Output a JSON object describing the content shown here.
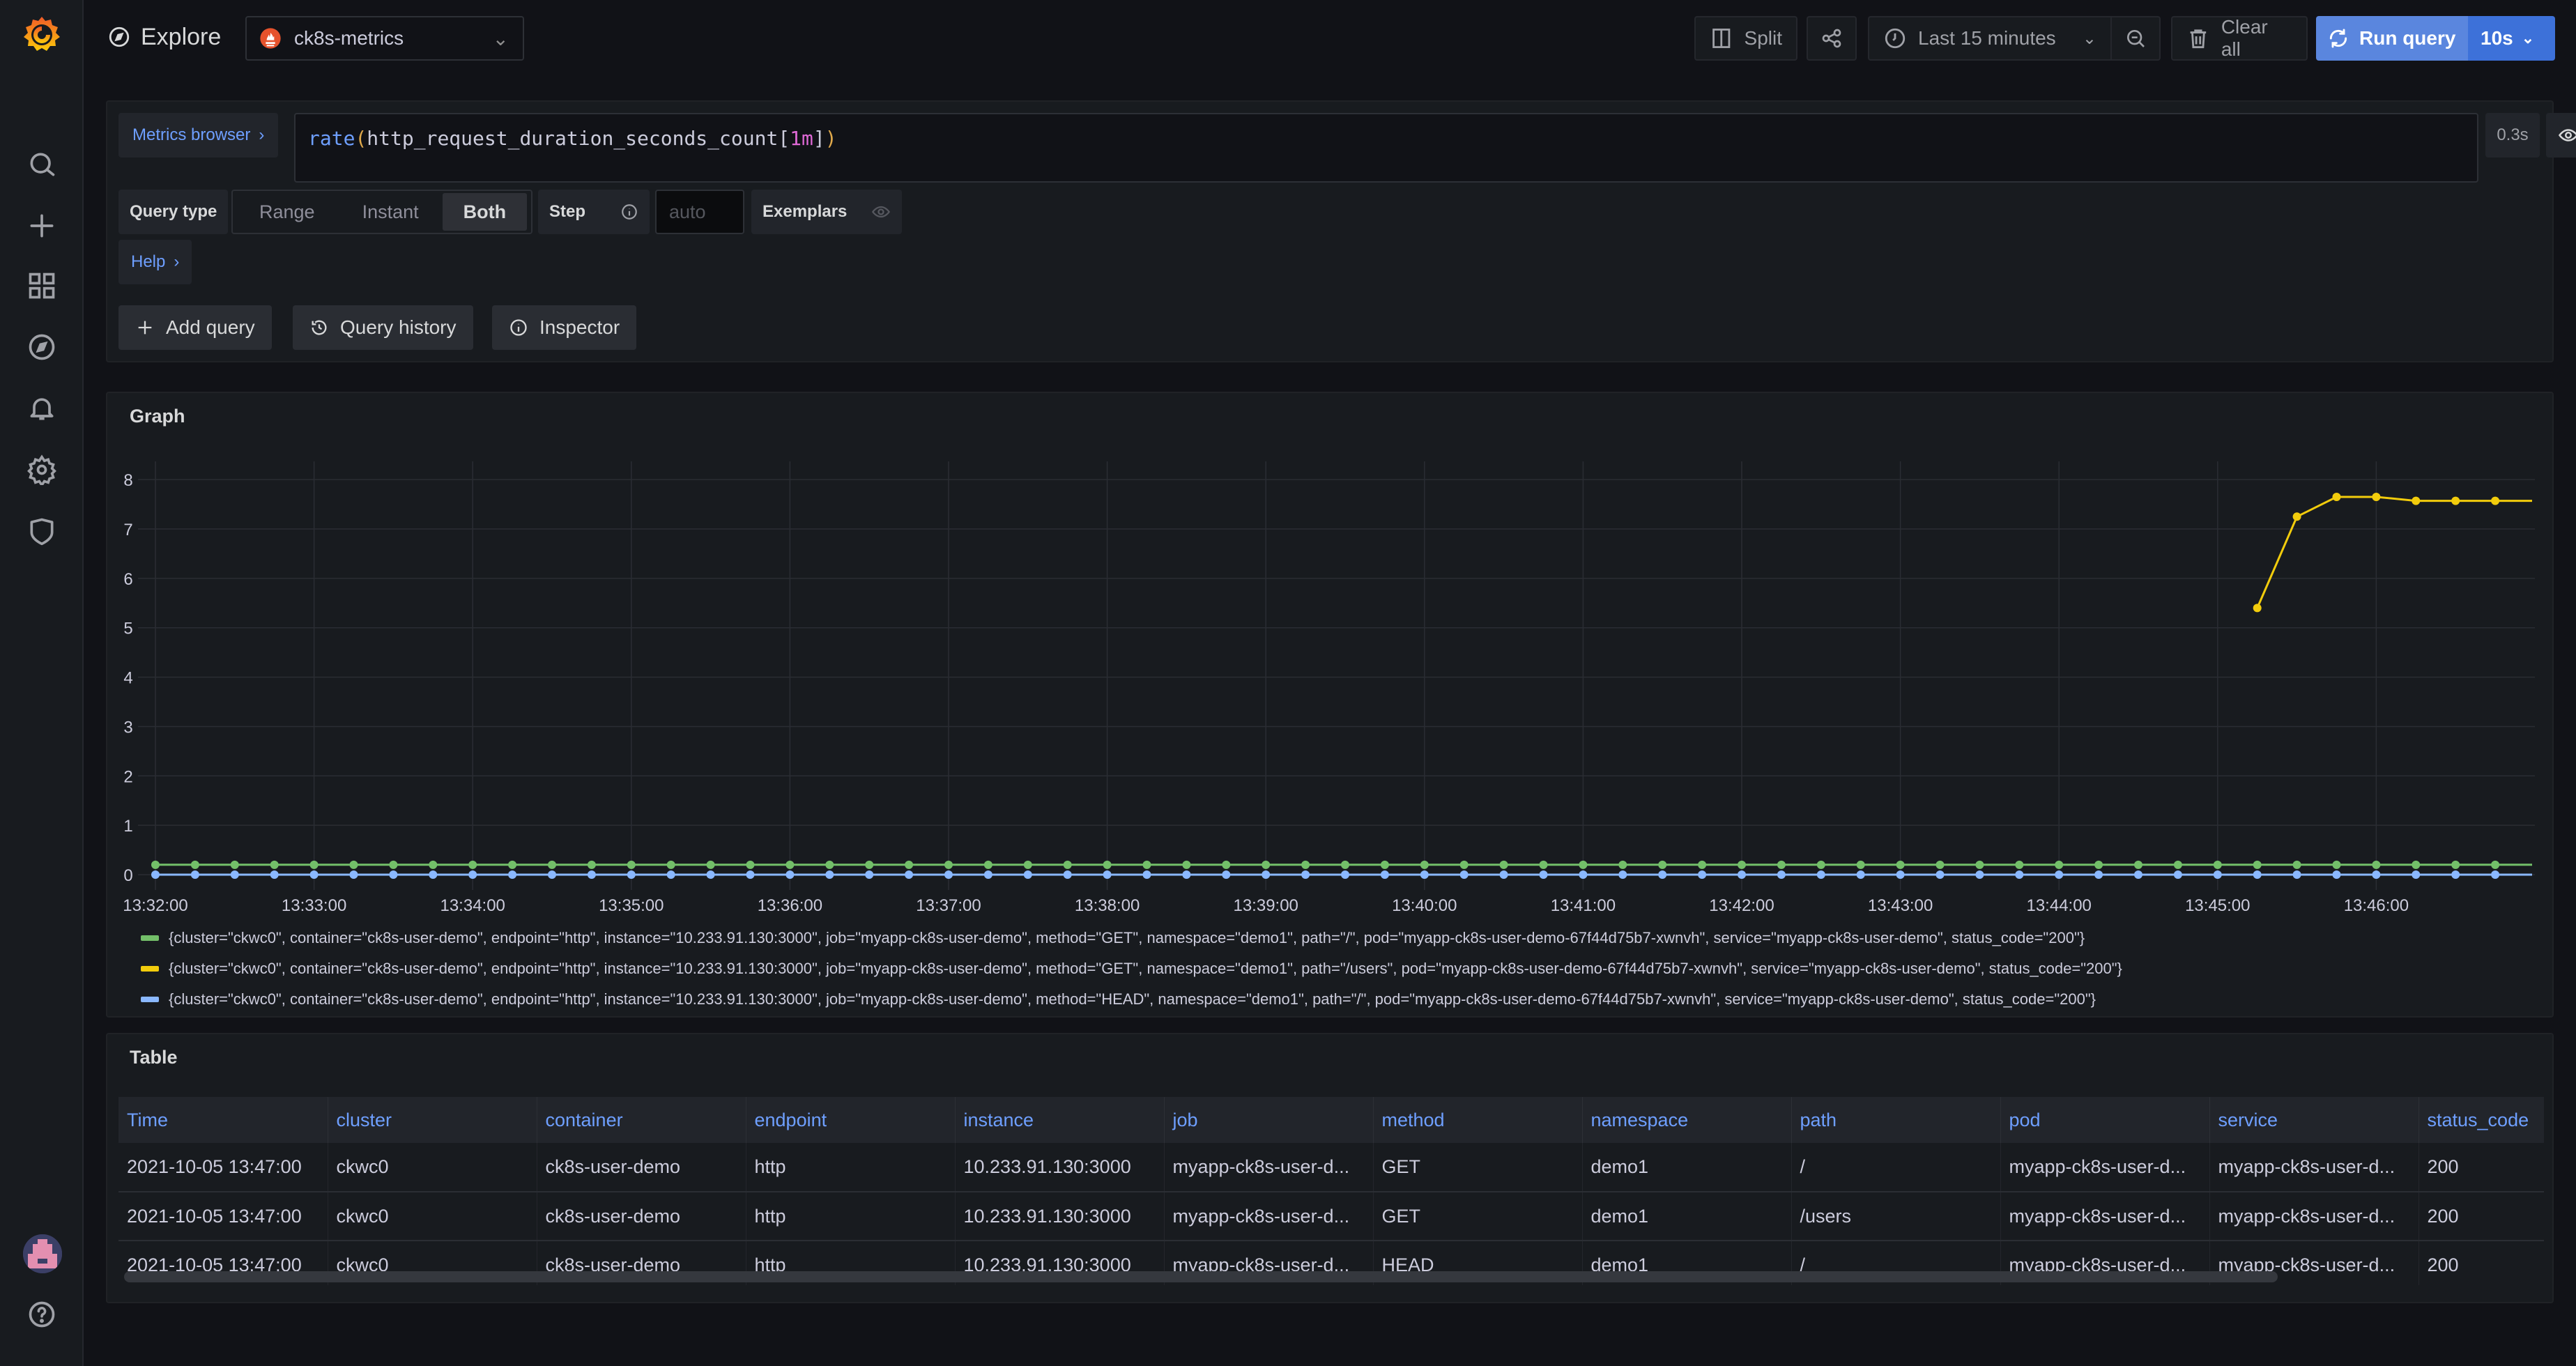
{
  "sidebar": {
    "items": [
      {
        "name": "search",
        "label": "Search"
      },
      {
        "name": "create",
        "label": "Create"
      },
      {
        "name": "dashboards",
        "label": "Dashboards"
      },
      {
        "name": "explore",
        "label": "Explore"
      },
      {
        "name": "alerting",
        "label": "Alerting"
      },
      {
        "name": "configuration",
        "label": "Configuration"
      },
      {
        "name": "server-admin",
        "label": "Server Admin"
      }
    ]
  },
  "topbar": {
    "title": "Explore",
    "datasource": "ck8s-metrics",
    "split_label": "Split",
    "time_range": "Last 15 minutes",
    "clear_all_label": "Clear all",
    "run_query_label": "Run query",
    "refresh_interval": "10s"
  },
  "query": {
    "metrics_browser_label": "Metrics browser",
    "expression_fn": "rate",
    "expression_metric": "http_request_duration_seconds_count",
    "expression_range": "1m",
    "duration": "0.3s",
    "query_type_label": "Query type",
    "query_type_options": [
      "Range",
      "Instant",
      "Both"
    ],
    "query_type_selected": "Both",
    "step_label": "Step",
    "step_placeholder": "auto",
    "exemplars_label": "Exemplars",
    "help_label": "Help",
    "add_query_label": "Add query",
    "query_history_label": "Query history",
    "inspector_label": "Inspector"
  },
  "graph": {
    "title": "Graph"
  },
  "chart_data": {
    "type": "line",
    "title": "Graph",
    "xlabel": "",
    "ylabel": "",
    "x_ticks": [
      "13:32:00",
      "13:33:00",
      "13:34:00",
      "13:35:00",
      "13:36:00",
      "13:37:00",
      "13:38:00",
      "13:39:00",
      "13:40:00",
      "13:41:00",
      "13:42:00",
      "13:43:00",
      "13:44:00",
      "13:45:00",
      "13:46:00"
    ],
    "y_ticks": [
      0,
      1,
      2,
      3,
      4,
      5,
      6,
      7,
      8
    ],
    "ylim": [
      0,
      8.2
    ],
    "xlim": [
      "13:32:00",
      "13:47:00"
    ],
    "grid": true,
    "legend_position": "bottom",
    "sample_interval_seconds": 15,
    "series": [
      {
        "name": "{cluster=\"ckwc0\", container=\"ck8s-user-demo\", endpoint=\"http\", instance=\"10.233.91.130:3000\", job=\"myapp-ck8s-user-demo\", method=\"GET\", namespace=\"demo1\", path=\"/\", pod=\"myapp-ck8s-user-demo-67f44d75b7-xwnvh\", service=\"myapp-ck8s-user-demo\", status_code=\"200\"}",
        "color": "#73bf69",
        "start": "13:32:00",
        "values": [
          0.2,
          0.2,
          0.2,
          0.2,
          0.2,
          0.2,
          0.2,
          0.2,
          0.2,
          0.2,
          0.2,
          0.2,
          0.2,
          0.2,
          0.2,
          0.2,
          0.2,
          0.2,
          0.2,
          0.2,
          0.2,
          0.2,
          0.2,
          0.2,
          0.2,
          0.2,
          0.2,
          0.2,
          0.2,
          0.2,
          0.2,
          0.2,
          0.2,
          0.2,
          0.2,
          0.2,
          0.2,
          0.2,
          0.2,
          0.2,
          0.2,
          0.2,
          0.2,
          0.2,
          0.2,
          0.2,
          0.2,
          0.2,
          0.2,
          0.2,
          0.2,
          0.2,
          0.2,
          0.2,
          0.2,
          0.2,
          0.2,
          0.2,
          0.2,
          0.2
        ]
      },
      {
        "name": "{cluster=\"ckwc0\", container=\"ck8s-user-demo\", endpoint=\"http\", instance=\"10.233.91.130:3000\", job=\"myapp-ck8s-user-demo\", method=\"GET\", namespace=\"demo1\", path=\"/users\", pod=\"myapp-ck8s-user-demo-67f44d75b7-xwnvh\", service=\"myapp-ck8s-user-demo\", status_code=\"200\"}",
        "color": "#f2cc0c",
        "start": "13:45:15",
        "values": [
          5.4,
          7.25,
          7.65,
          7.65,
          7.57,
          7.57,
          7.57
        ]
      },
      {
        "name": "{cluster=\"ckwc0\", container=\"ck8s-user-demo\", endpoint=\"http\", instance=\"10.233.91.130:3000\", job=\"myapp-ck8s-user-demo\", method=\"HEAD\", namespace=\"demo1\", path=\"/\", pod=\"myapp-ck8s-user-demo-67f44d75b7-xwnvh\", service=\"myapp-ck8s-user-demo\", status_code=\"200\"}",
        "color": "#8ab8ff",
        "start": "13:32:00",
        "values": [
          0,
          0,
          0,
          0,
          0,
          0,
          0,
          0,
          0,
          0,
          0,
          0,
          0,
          0,
          0,
          0,
          0,
          0,
          0,
          0,
          0,
          0,
          0,
          0,
          0,
          0,
          0,
          0,
          0,
          0,
          0,
          0,
          0,
          0,
          0,
          0,
          0,
          0,
          0,
          0,
          0,
          0,
          0,
          0,
          0,
          0,
          0,
          0,
          0,
          0,
          0,
          0,
          0,
          0,
          0,
          0,
          0,
          0,
          0,
          0
        ]
      }
    ]
  },
  "table": {
    "title": "Table",
    "columns": [
      "Time",
      "cluster",
      "container",
      "endpoint",
      "instance",
      "job",
      "method",
      "namespace",
      "path",
      "pod",
      "service",
      "status_code"
    ],
    "rows": [
      [
        "2021-10-05 13:47:00",
        "ckwc0",
        "ck8s-user-demo",
        "http",
        "10.233.91.130:3000",
        "myapp-ck8s-user-d...",
        "GET",
        "demo1",
        "/",
        "myapp-ck8s-user-d...",
        "myapp-ck8s-user-d...",
        "200"
      ],
      [
        "2021-10-05 13:47:00",
        "ckwc0",
        "ck8s-user-demo",
        "http",
        "10.233.91.130:3000",
        "myapp-ck8s-user-d...",
        "GET",
        "demo1",
        "/users",
        "myapp-ck8s-user-d...",
        "myapp-ck8s-user-d...",
        "200"
      ],
      [
        "2021-10-05 13:47:00",
        "ckwc0",
        "ck8s-user-demo",
        "http",
        "10.233.91.130:3000",
        "myapp-ck8s-user-d...",
        "HEAD",
        "demo1",
        "/",
        "myapp-ck8s-user-d...",
        "myapp-ck8s-user-d...",
        "200"
      ]
    ]
  }
}
